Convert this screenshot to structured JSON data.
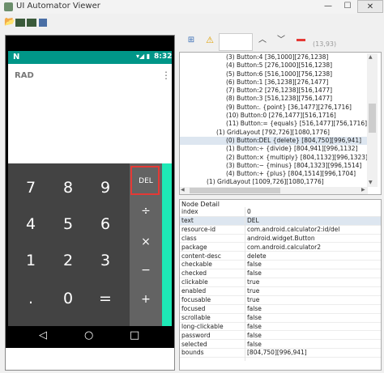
{
  "window": {
    "title": "UI Automator Viewer",
    "close_glyph": "✕"
  },
  "toolbar": {
    "icons": [
      "open-icon",
      "screenshot-icon",
      "compressed-screenshot-icon",
      "save-icon"
    ]
  },
  "device": {
    "status_bar": {
      "logo": "N",
      "icons": "▾◢ ▮",
      "time": "8:32"
    },
    "display_mode": "RAD",
    "menu_glyph": "⋮",
    "keys": [
      "7",
      "8",
      "9",
      "4",
      "5",
      "6",
      "1",
      "2",
      "3",
      ".",
      "0",
      "="
    ],
    "ops": [
      "DEL",
      "÷",
      "×",
      "−",
      "+"
    ],
    "nav": {
      "back": "◁",
      "home": "○",
      "recent": "□"
    }
  },
  "right_toolbar": {
    "icons": [
      "expand-icon",
      "warning-icon",
      "up-arrow-icon",
      "down-arrow-icon",
      "remove-icon"
    ],
    "coords": "(13,93)"
  },
  "tree": {
    "nodes": [
      {
        "text": "(3) Button:4 [36,1000][276,1238]",
        "indent": 57
      },
      {
        "text": "(4) Button:5 [276,1000][516,1238]",
        "indent": 57
      },
      {
        "text": "(5) Button:6 [516,1000][756,1238]",
        "indent": 57
      },
      {
        "text": "(6) Button:1 [36,1238][276,1477]",
        "indent": 57
      },
      {
        "text": "(7) Button:2 [276,1238][516,1477]",
        "indent": 57
      },
      {
        "text": "(8) Button:3 [516,1238][756,1477]",
        "indent": 57
      },
      {
        "text": "(9) Button:. {point} [36,1477][276,1716]",
        "indent": 57
      },
      {
        "text": "(10) Button:0 [276,1477][516,1716]",
        "indent": 57
      },
      {
        "text": "(11) Button:= {equals} [516,1477][756,1716]",
        "indent": 57
      },
      {
        "text": "(1) GridLayout [792,726][1080,1776]",
        "indent": 45
      },
      {
        "text": "(0) Button:DEL {delete} [804,750][996,941]",
        "indent": 57,
        "selected": true
      },
      {
        "text": "(1) Button:÷ {divide} [804,941][996,1132]",
        "indent": 57
      },
      {
        "text": "(2) Button:× {multiply} [804,1132][996,1323]",
        "indent": 57
      },
      {
        "text": "(3) Button:− {minus} [804,1323][996,1514]",
        "indent": 57
      },
      {
        "text": "(4) Button:+ {plus} [804,1514][996,1704]",
        "indent": 57
      },
      {
        "text": "(1) GridLayout [1009,726][1080,1776]",
        "indent": 33
      }
    ]
  },
  "detail": {
    "title": "Node Detail",
    "rows": [
      {
        "key": "index",
        "value": "0"
      },
      {
        "key": "text",
        "value": "DEL",
        "selected": true
      },
      {
        "key": "resource-id",
        "value": "com.android.calculator2:id/del"
      },
      {
        "key": "class",
        "value": "android.widget.Button"
      },
      {
        "key": "package",
        "value": "com.android.calculator2"
      },
      {
        "key": "content-desc",
        "value": "delete"
      },
      {
        "key": "checkable",
        "value": "false"
      },
      {
        "key": "checked",
        "value": "false"
      },
      {
        "key": "clickable",
        "value": "true"
      },
      {
        "key": "enabled",
        "value": "true"
      },
      {
        "key": "focusable",
        "value": "true"
      },
      {
        "key": "focused",
        "value": "false"
      },
      {
        "key": "scrollable",
        "value": "false"
      },
      {
        "key": "long-clickable",
        "value": "false"
      },
      {
        "key": "password",
        "value": "false"
      },
      {
        "key": "selected",
        "value": "false"
      },
      {
        "key": "bounds",
        "value": "[804,750][996,941]"
      }
    ]
  }
}
